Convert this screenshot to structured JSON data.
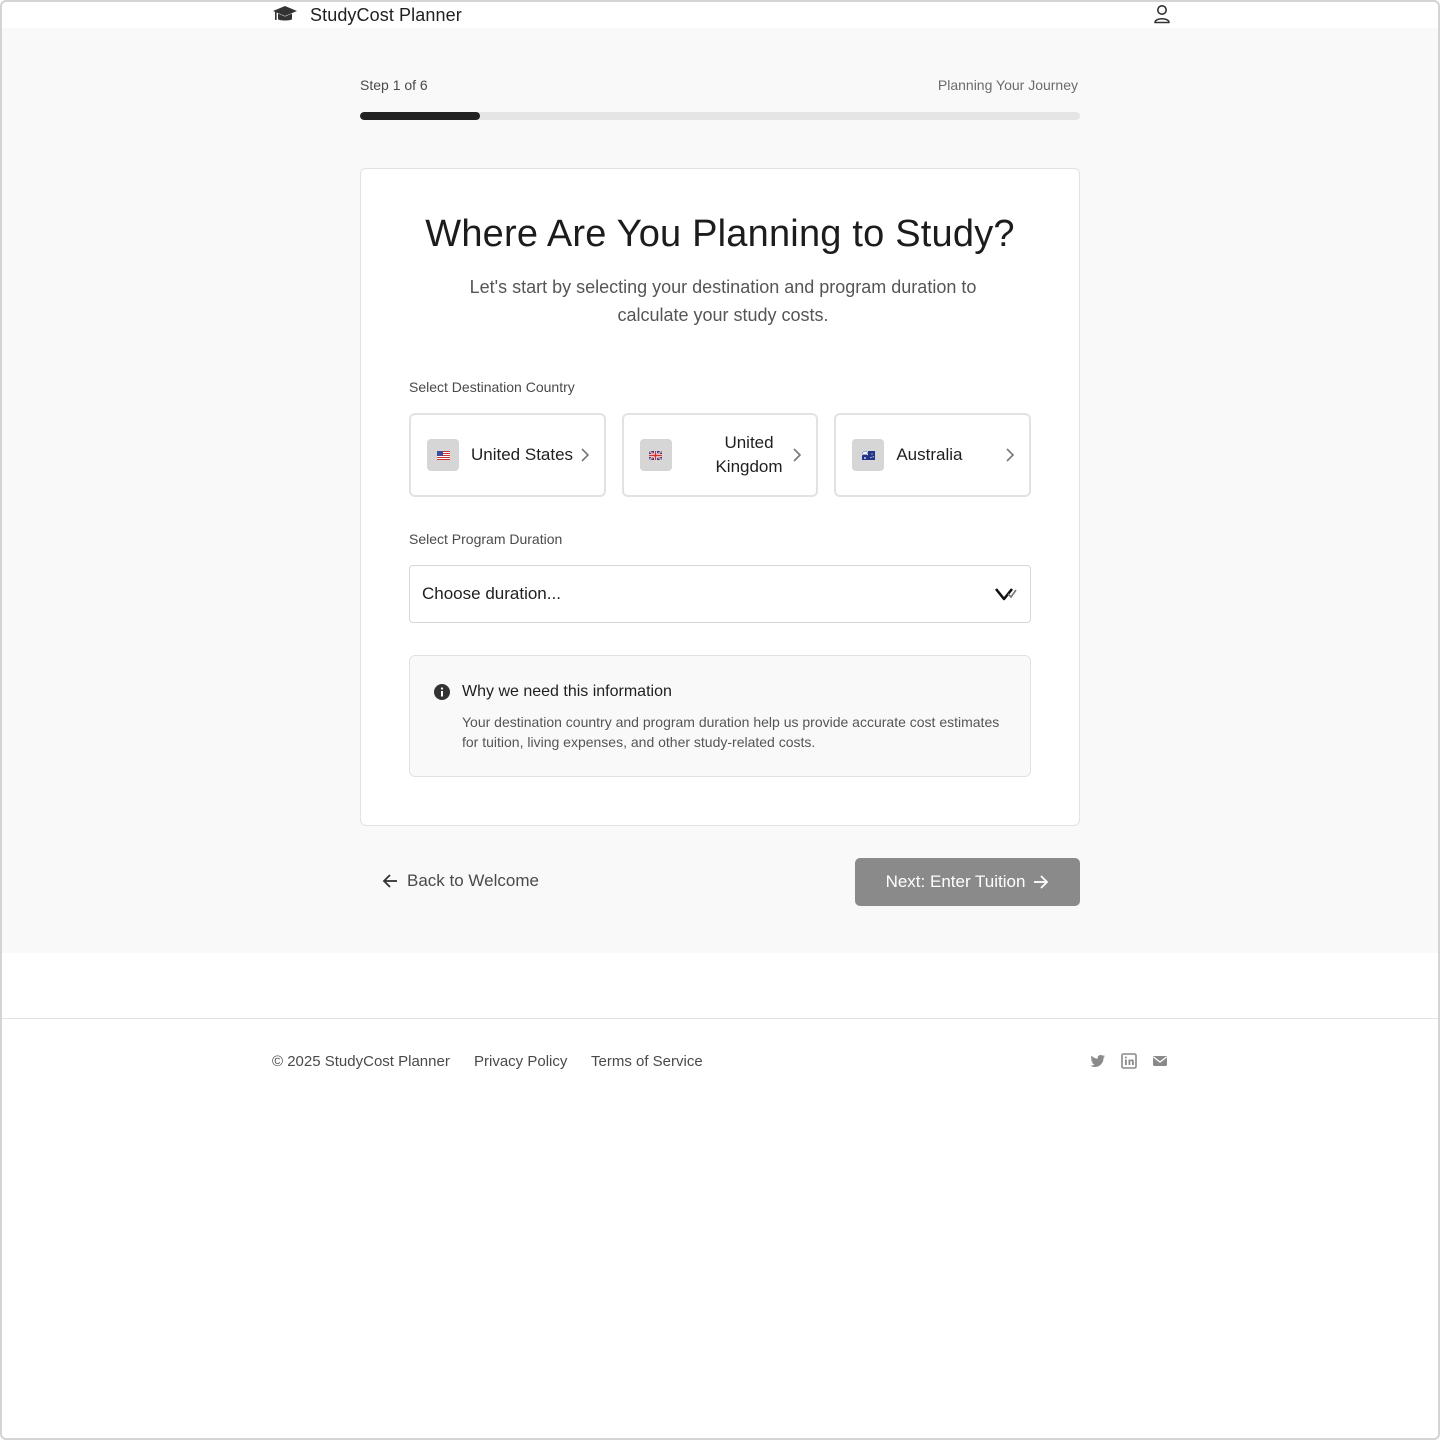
{
  "header": {
    "brand_name": "StudyCost Planner",
    "brand_icon": "graduation-cap-icon",
    "user_icon": "user-icon"
  },
  "progress": {
    "step_label": "Step 1 of 6",
    "caption": "Planning Your Journey",
    "current_step": 1,
    "total_steps": 6
  },
  "card": {
    "title": "Where Are You Planning to Study?",
    "subtitle": "Let's start by selecting your destination and program duration to calculate your study costs.",
    "country_label": "Select Destination Country",
    "countries": [
      {
        "name": "United States",
        "flag_icon": "us-flag-icon"
      },
      {
        "name": "United Kingdom",
        "flag_icon": "uk-flag-icon"
      },
      {
        "name": "Australia",
        "flag_icon": "australia-flag-icon"
      }
    ],
    "duration_label": "Select Program Duration",
    "duration_placeholder": "Choose duration...",
    "info": {
      "title": "Why we need this information",
      "text": "Your destination country and program duration help us provide accurate cost estimates for tuition, living expenses, and other study-related costs."
    }
  },
  "navigation": {
    "back_label": "Back to Welcome",
    "next_label": "Next: Enter Tuition"
  },
  "footer": {
    "copyright": "© 2025 StudyCost Planner",
    "privacy": "Privacy Policy",
    "terms": "Terms of Service",
    "social_icons": [
      "twitter-icon",
      "linkedin-icon",
      "email-icon"
    ]
  },
  "colors": {
    "page_bg": "#f9f9f9",
    "progress_fill": "#222222",
    "progress_track": "#e5e5e5",
    "button_bg": "#8a8a8a"
  }
}
